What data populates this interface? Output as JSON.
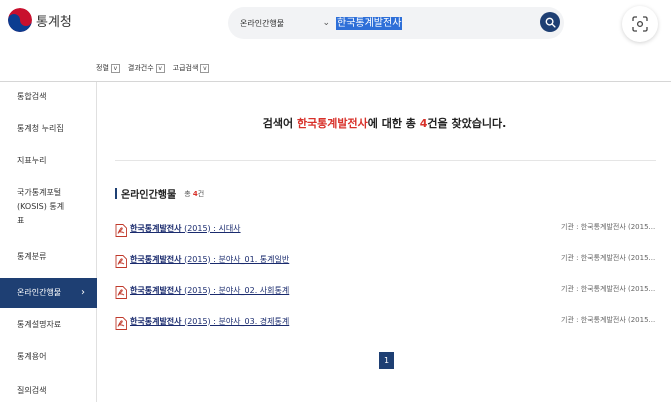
{
  "header": {
    "logo_text": "통계청",
    "search": {
      "scope": "온라인간행물",
      "query": "한국통계발전사"
    }
  },
  "filters": [
    {
      "label": "정렬"
    },
    {
      "label": "결과건수"
    },
    {
      "label": "고급검색"
    }
  ],
  "sidebar": {
    "items": [
      {
        "label": "통합검색"
      },
      {
        "label": "통계청 누리집"
      },
      {
        "label": "지표누리"
      },
      {
        "label": "국가통계포털\n(KOSIS) 통계\n표"
      },
      {
        "label": "통계분류"
      },
      {
        "label": "온라인간행물"
      },
      {
        "label": "통계설명자료"
      },
      {
        "label": "통계용어"
      },
      {
        "label": "질의검색"
      }
    ],
    "active_index": 5
  },
  "result": {
    "prefix": "검색어 ",
    "keyword": "한국통계발전사",
    "middle": "에 대한 총 ",
    "count": "4",
    "suffix": "건을 찾았습니다."
  },
  "section": {
    "name": "온라인간행물",
    "count_prefix": "총",
    "count": "4",
    "count_unit": "건"
  },
  "items": [
    {
      "keyword": "한국통계발전사",
      "rest": " (2015) : 시대사",
      "source": "기관 : 한국통계발전사 (2015..."
    },
    {
      "keyword": "한국통계발전사",
      "rest": " (2015) : 분야사_01. 통계일반",
      "source": "기관 : 한국통계발전사 (2015..."
    },
    {
      "keyword": "한국통계발전사",
      "rest": " (2015) : 분야사_02. 사회통계",
      "source": "기관 : 한국통계발전사 (2015..."
    },
    {
      "keyword": "한국통계발전사",
      "rest": " (2015) : 분야사_03. 경제통계",
      "source": "기관 : 한국통계발전사 (2015..."
    }
  ],
  "pagination": {
    "current": "1"
  },
  "colors": {
    "navy": "#1e3f73",
    "accent_red": "#d8312a",
    "link": "#1a2b6e"
  },
  "icons": {
    "logo": "taegeuk-logo-icon",
    "search": "search-icon",
    "scan": "scan-icon",
    "pdf": "pdf-file-icon",
    "active_arrow": "chevron-right-icon"
  }
}
